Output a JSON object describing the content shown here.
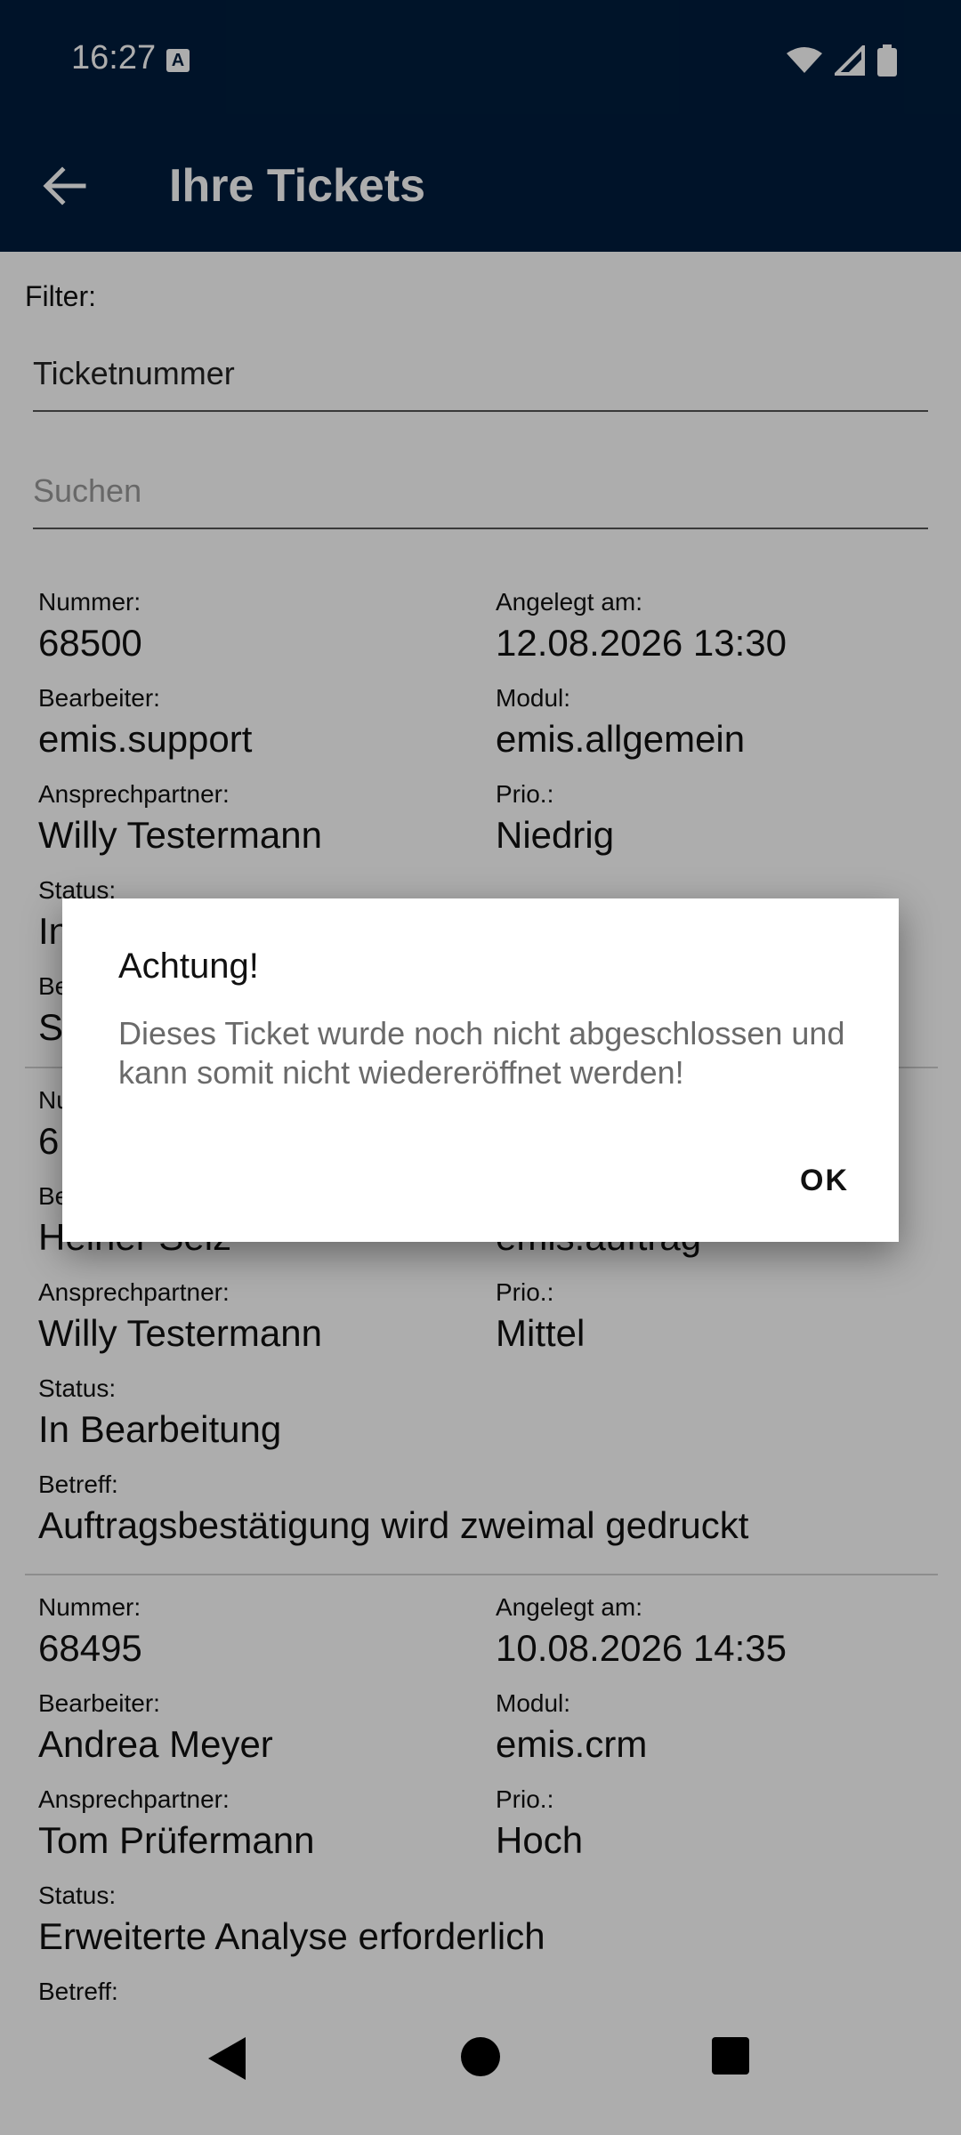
{
  "statusbar": {
    "time": "16:27",
    "notification_icon": "A"
  },
  "appbar": {
    "title": "Ihre Tickets"
  },
  "filter": {
    "label": "Filter:",
    "dropdown_value": "Ticketnummer",
    "search_placeholder": "Suchen"
  },
  "labels": {
    "nummer": "Nummer:",
    "angelegt": "Angelegt am:",
    "bearbeiter": "Bearbeiter:",
    "modul": "Modul:",
    "ansprechpartner": "Ansprechpartner:",
    "prio": "Prio.:",
    "status": "Status:",
    "betreff": "Betreff:"
  },
  "tickets": [
    {
      "nummer": "68500",
      "angelegt": "12.08.2026 13:30",
      "bearbeiter": "emis.support",
      "modul": "emis.allgemein",
      "ansprechpartner": "Willy Testermann",
      "prio": "Niedrig",
      "status": "In",
      "betreff": "S"
    },
    {
      "nummer": "6",
      "angelegt": "",
      "bearbeiter": "Heiner Seiz",
      "modul": "emis.auftrag",
      "ansprechpartner": "Willy Testermann",
      "prio": "Mittel",
      "status": "In Bearbeitung",
      "betreff": "Auftragsbestätigung wird zweimal gedruckt"
    },
    {
      "nummer": "68495",
      "angelegt": "10.08.2026 14:35",
      "bearbeiter": "Andrea Meyer",
      "modul": "emis.crm",
      "ansprechpartner": "Tom Prüfermann",
      "prio": "Hoch",
      "status": "Erweiterte Analyse erforderlich"
    }
  ],
  "dialog": {
    "title": "Achtung!",
    "message": "Dieses Ticket wurde noch nicht abgeschlossen und kann somit nicht wiedereröffnet werden!",
    "ok_label": "OK"
  },
  "colors": {
    "primary": "#001d3d",
    "scrim": "#00000052"
  }
}
